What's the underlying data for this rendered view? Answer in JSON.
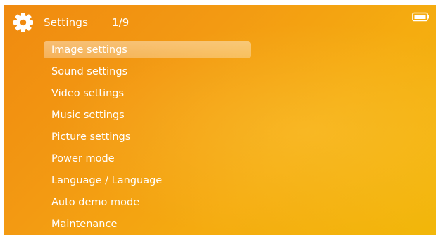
{
  "header": {
    "title": "Settings",
    "page_indicator": "1/9",
    "icon": "gear-icon"
  },
  "status": {
    "battery_icon": "battery-icon",
    "battery_level": 1.0
  },
  "menu": {
    "selected_index": 0,
    "items": [
      {
        "label": "Image settings"
      },
      {
        "label": "Sound settings"
      },
      {
        "label": "Video settings"
      },
      {
        "label": "Music settings"
      },
      {
        "label": "Picture settings"
      },
      {
        "label": "Power mode"
      },
      {
        "label": "Language / Language"
      },
      {
        "label": "Auto demo mode"
      },
      {
        "label": "Maintenance"
      }
    ]
  },
  "colors": {
    "background_start": "#f08a10",
    "background_end": "#f2b70a",
    "text": "#ffffff",
    "selection": "rgba(255,255,255,0.38)"
  }
}
